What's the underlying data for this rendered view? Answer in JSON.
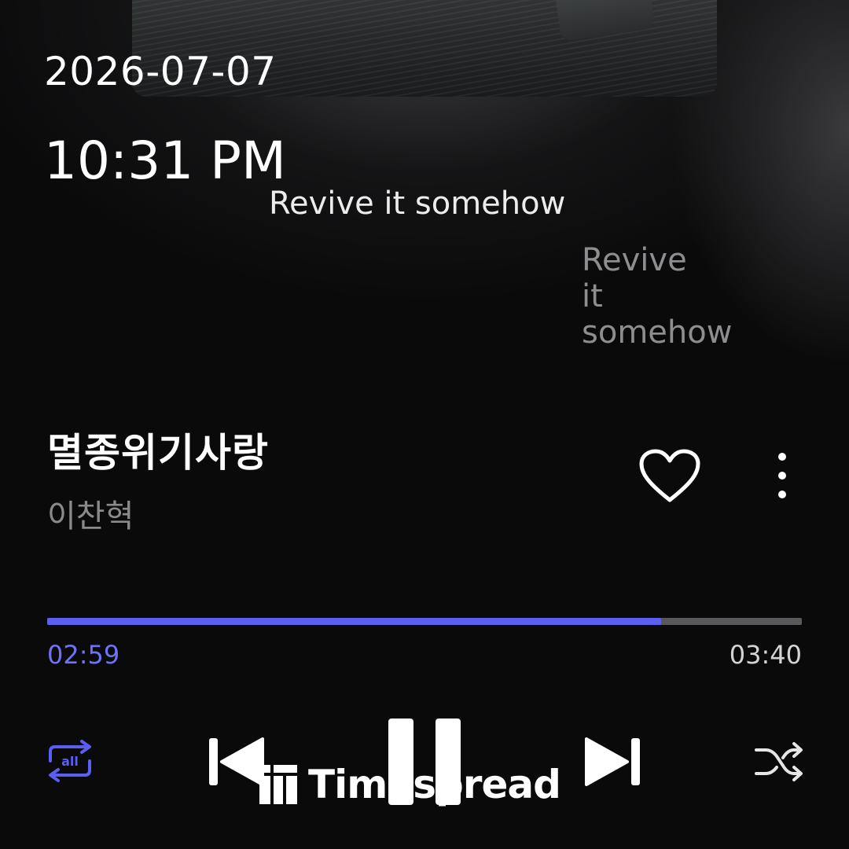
{
  "status": {
    "date": "2026-07-07",
    "time": "10:31 PM"
  },
  "lyrics": {
    "current": "Revive it somehow",
    "next": "Revive it somehow"
  },
  "song": {
    "title": "멸종위기사랑",
    "artist": "이찬혁",
    "liked": false
  },
  "playback": {
    "elapsed": "02:59",
    "duration": "03:40",
    "progress_fraction": 0.8136,
    "repeat_mode_label": "all",
    "state": "playing"
  },
  "icons": {
    "like": "heart-outline-icon",
    "more": "more-vertical-icon",
    "repeat": "repeat-all-icon",
    "previous": "skip-previous-icon",
    "pause": "pause-icon",
    "next": "skip-next-icon",
    "shuffle": "shuffle-icon"
  },
  "colors": {
    "accent": "#5b5ef0",
    "track": "#59595b",
    "background": "#0a0a0b"
  },
  "watermark": {
    "text": "Timespread"
  }
}
